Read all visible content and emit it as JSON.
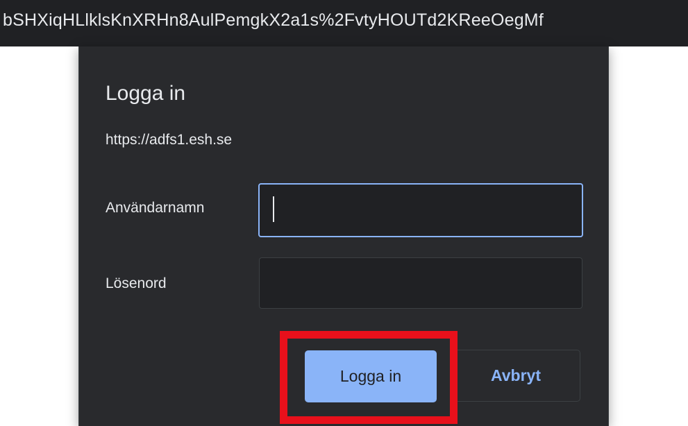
{
  "address_bar": {
    "url_fragment": "bSHXiqHLlklsKnXRHn8AulPemgkX2a1s%2FvtyHOUTd2KReeOegMf"
  },
  "dialog": {
    "title": "Logga in",
    "origin": "https://adfs1.esh.se",
    "username_label": "Användarnamn",
    "username_value": "",
    "password_label": "Lösenord",
    "password_value": "",
    "login_button": "Logga in",
    "cancel_button": "Avbryt"
  },
  "colors": {
    "dialog_bg": "#292a2d",
    "input_bg": "#202124",
    "accent": "#8ab4f8",
    "highlight": "#e8101b"
  }
}
